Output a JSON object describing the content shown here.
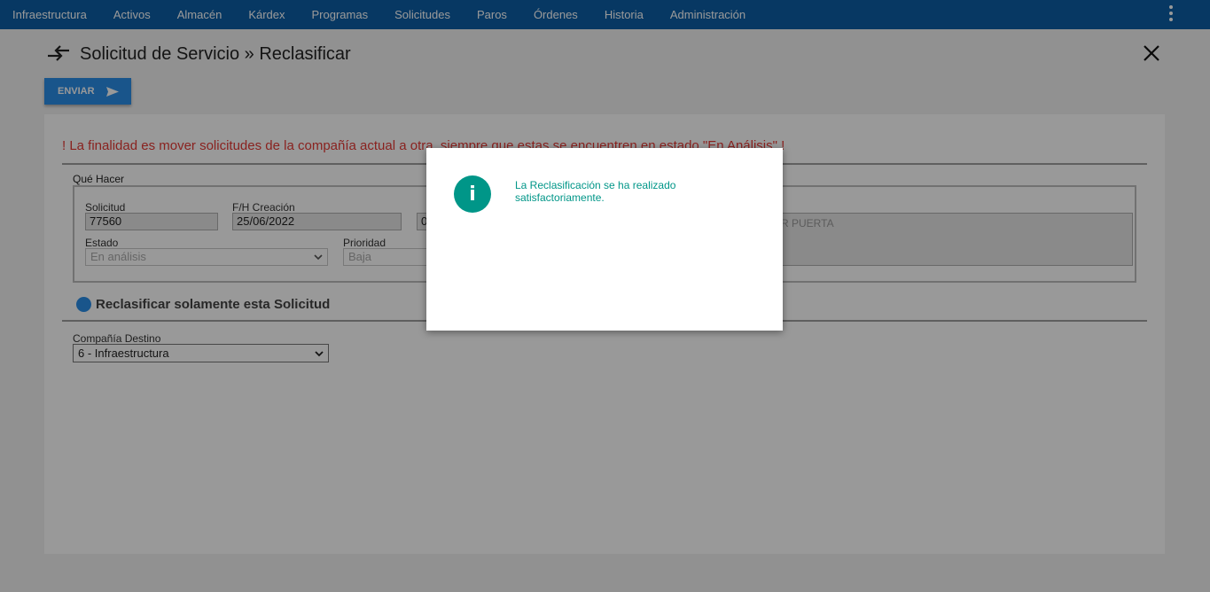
{
  "nav": {
    "items": [
      "Infraestructura",
      "Activos",
      "Almacén",
      "Kárdex",
      "Programas",
      "Solicitudes",
      "Paros",
      "Órdenes",
      "Historia",
      "Administración"
    ],
    "menu_icon": "kebab-menu-icon"
  },
  "header": {
    "title": "Solicitud de Servicio » Reclasificar",
    "icon": "swap-arrows-icon",
    "close_icon": "close-icon"
  },
  "toolbar": {
    "send_label": "ENVIAR",
    "send_icon": "send-icon"
  },
  "form": {
    "warning": "! La finalidad es mover solicitudes de la compañía actual a otra, siempre que estas se encuentren en estado \"En Análisis\" !",
    "fieldset_legend": "Qué Hacer",
    "solicitud_label": "Solicitud",
    "solicitud_value": "77560",
    "fecha_label": "F/H Creación",
    "fecha_value": "25/06/2022",
    "hora_value": "0",
    "estado_label": "Estado",
    "estado_value": "En análisis",
    "prioridad_label": "Prioridad",
    "prioridad_value": "Baja",
    "descripcion_value": "R PUERTA",
    "radio_label": "Reclasificar solamente esta Solicitud",
    "destino_label": "Compañía Destino",
    "destino_value": "6 - Infraestructura"
  },
  "dialog": {
    "icon": "info-icon",
    "icon_glyph": "i",
    "message": "La Reclasificación se ha realizado satisfactoriamente."
  },
  "colors": {
    "nav_bg": "#0d5ea6",
    "accent": "#2b8ee8",
    "warning": "#e53935",
    "success": "#009688"
  }
}
